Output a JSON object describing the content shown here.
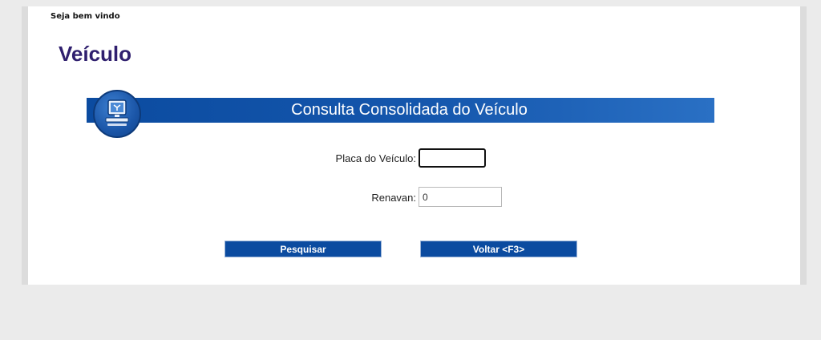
{
  "header": {
    "welcome": "Seja bem vindo",
    "page_title": "Veículo"
  },
  "banner": {
    "title": "Consulta Consolidada do Veículo",
    "icon": "computer-monitor-icon"
  },
  "form": {
    "placa_label": "Placa do Veículo:",
    "placa_value": "",
    "renavan_label": "Renavan:",
    "renavan_value": "0"
  },
  "buttons": {
    "search_label": "Pesquisar",
    "back_label": "Voltar <F3>"
  },
  "colors": {
    "accent": "#0b4ba0",
    "title": "#2f1f6e"
  }
}
